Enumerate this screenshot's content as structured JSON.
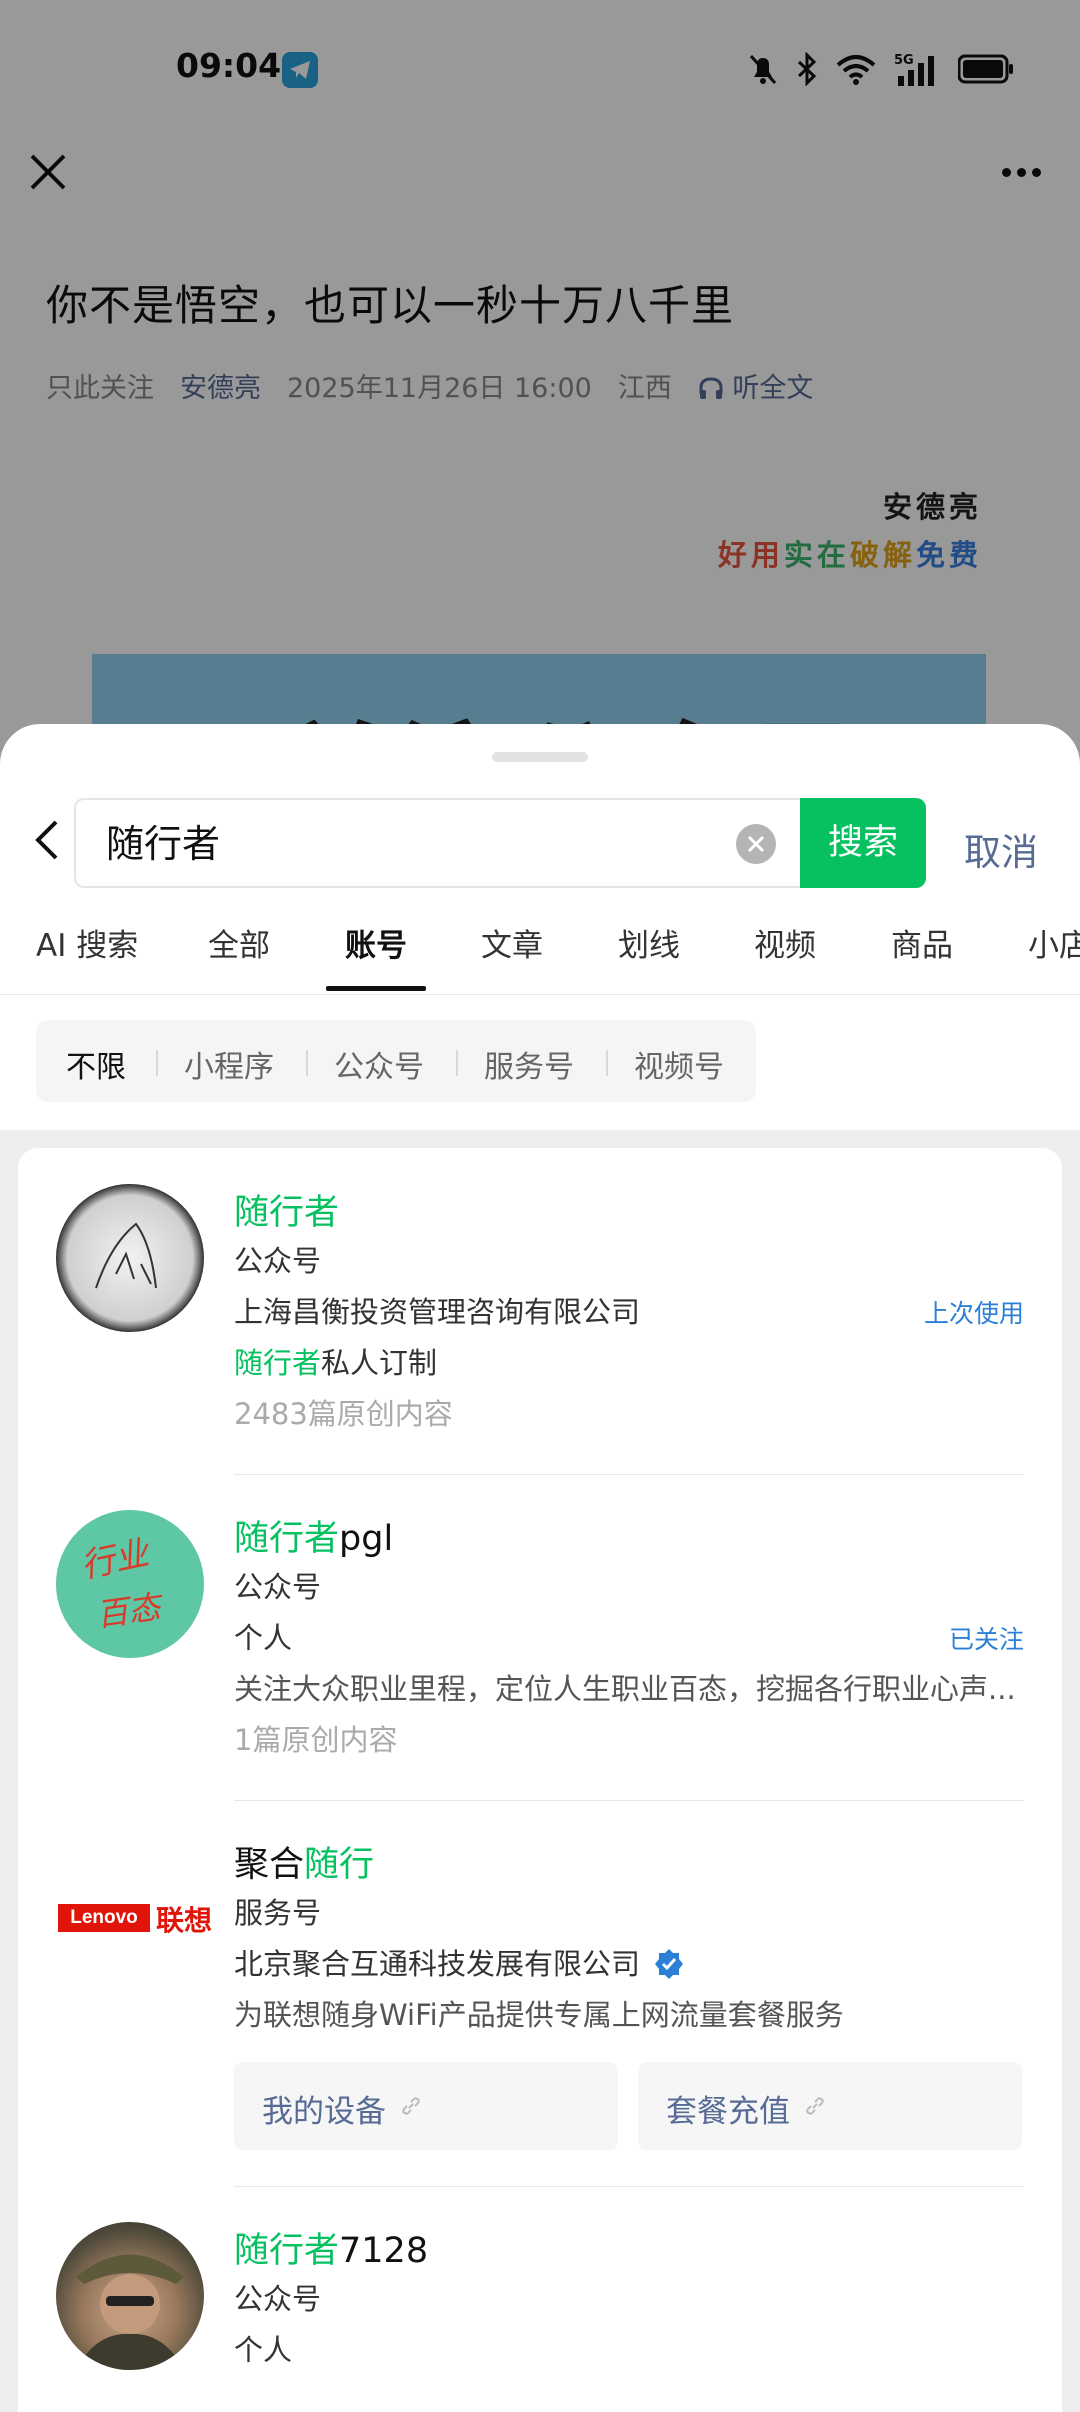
{
  "status_bar": {
    "time": "09:04"
  },
  "article": {
    "title": "你不是悟空，也可以一秒十万八千里",
    "meta": {
      "account": "只此关注",
      "author": "安德亮",
      "datetime": "2025年11月26日 16:00",
      "location": "江西",
      "listen": "听全文"
    },
    "signature_name": "安德亮",
    "slogan": [
      {
        "text": "好",
        "color": "#e8573f"
      },
      {
        "text": "用",
        "color": "#e8573f"
      },
      {
        "text": "实",
        "color": "#3bb26b"
      },
      {
        "text": "在",
        "color": "#3bb26b"
      },
      {
        "text": "破",
        "color": "#e0a21c"
      },
      {
        "text": "解",
        "color": "#e0a21c"
      },
      {
        "text": "免",
        "color": "#3a7fe0"
      },
      {
        "text": "费",
        "color": "#3a7fe0"
      }
    ],
    "banner_text": "关注公众号"
  },
  "search": {
    "query": "随行者",
    "search_button": "搜索",
    "cancel_button": "取消"
  },
  "tabs": [
    "AI 搜索",
    "全部",
    "账号",
    "文章",
    "划线",
    "视频",
    "商品",
    "小店"
  ],
  "active_tab": "账号",
  "filters": [
    "不限",
    "小程序",
    "公众号",
    "服务号",
    "视频号"
  ],
  "active_filter": "不限",
  "results": [
    {
      "name_highlight": "随行者",
      "name_rest": "",
      "type": "公众号",
      "owner": "上海昌衡投资管理咨询有限公司",
      "tag": "上次使用",
      "desc_highlight": "随行者",
      "desc_rest": "私人订制",
      "count": "2483篇原创内容"
    },
    {
      "name_highlight": "随行者",
      "name_rest": "pgl",
      "type": "公众号",
      "owner": "个人",
      "tag": "已关注",
      "desc": "关注大众职业里程，定位人生职业百态，挖掘各行职业心声...",
      "count": "1篇原创内容",
      "avatar_text_1": "行业",
      "avatar_text_2": "百态"
    },
    {
      "name_prefix": "聚合",
      "name_highlight": "随行",
      "type": "服务号",
      "owner": "北京聚合互通科技发展有限公司",
      "desc": "为联想随身WiFi产品提供专属上网流量套餐服务",
      "logo_en": "Lenovo",
      "logo_cn": "联想",
      "buttons": [
        "我的设备",
        "套餐充值"
      ]
    },
    {
      "name_highlight": "随行者",
      "name_rest": "7128",
      "type": "公众号",
      "owner": "个人"
    }
  ],
  "colors": {
    "accent_green": "#07c160",
    "link_blue": "#576b95",
    "tag_blue": "#2b7fd6",
    "verified_blue": "#2b7fd6"
  }
}
